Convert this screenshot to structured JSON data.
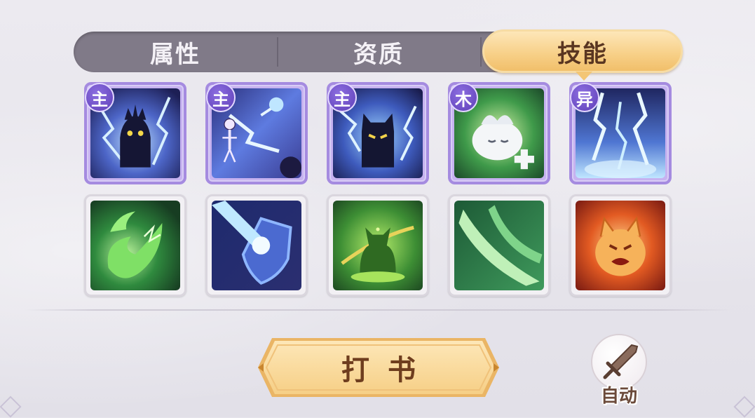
{
  "tabs": [
    {
      "label": "属性",
      "active": false
    },
    {
      "label": "资质",
      "active": false
    },
    {
      "label": "技能",
      "active": true
    }
  ],
  "skills_row1": [
    {
      "badge": "主",
      "icon": "shadow-beast-lightning-icon",
      "frame": "main"
    },
    {
      "badge": "主",
      "icon": "skeleton-lightning-icon",
      "frame": "main"
    },
    {
      "badge": "主",
      "icon": "cat-lightning-icon",
      "frame": "main"
    },
    {
      "badge": "木",
      "icon": "white-dragon-heal-icon",
      "frame": "main"
    },
    {
      "badge": "异",
      "icon": "lightning-storm-icon",
      "frame": "main"
    }
  ],
  "skills_row2": [
    {
      "icon": "green-fireball-icon",
      "frame": "normal"
    },
    {
      "icon": "shield-pierce-icon",
      "frame": "normal"
    },
    {
      "icon": "meditating-cat-icon",
      "frame": "normal"
    },
    {
      "icon": "green-slash-icon",
      "frame": "normal"
    },
    {
      "icon": "fire-beast-rage-icon",
      "frame": "normal"
    }
  ],
  "action_button": {
    "label": "打书"
  },
  "auto_button": {
    "label": "自动",
    "icon": "sword-icon"
  },
  "colors": {
    "tab_active": "#f7cf86",
    "tab_bar": "#807a88",
    "main_frame": "#a58be0",
    "badge": "#6b4cc6",
    "button_text": "#6e3d1e"
  }
}
